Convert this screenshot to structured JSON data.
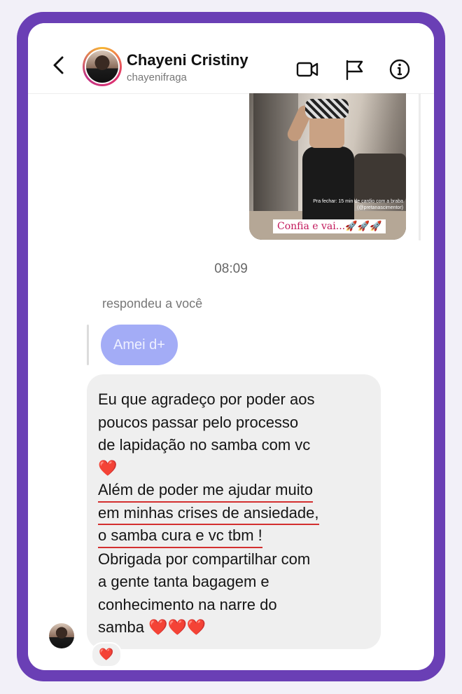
{
  "header": {
    "name": "Chayeni Cristiny",
    "username": "chayenifraga"
  },
  "story": {
    "small_text": "Pra fechar: 15 min de cardio com a braba (@pretanascimentor)",
    "caption": "Confia e vai...🚀🚀🚀"
  },
  "timestamp": "08:09",
  "reply": {
    "label": "respondeu a você",
    "quoted": "Amei d+"
  },
  "message": {
    "lines": [
      "Eu que agradeço por poder aos",
      "poucos passar pelo processo",
      "de lapidação no samba com vc",
      "❤️",
      "Além de poder me ajudar muito",
      "em minhas crises de ansiedade,",
      "o samba cura  e vc tbm !",
      "Obrigada por compartilhar com",
      "a gente tanta bagagem e",
      "conhecimento na narre do",
      "samba ❤️❤️❤️"
    ]
  },
  "reaction": "❤️",
  "icons": [
    "back-icon",
    "video-call-icon",
    "flag-icon",
    "info-icon"
  ],
  "colors": {
    "frame": "#6a3fb5",
    "reply_bubble": "#a3acf6",
    "underline": "#d32f2f"
  }
}
